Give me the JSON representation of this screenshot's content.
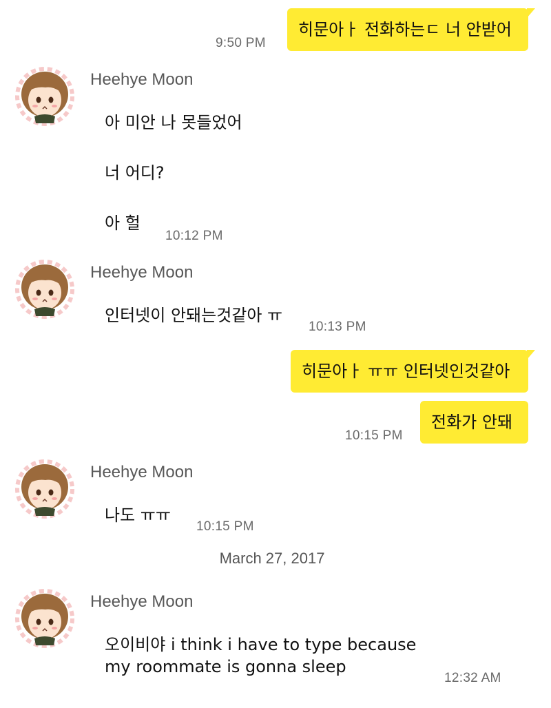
{
  "messages": {
    "m1": {
      "text": "히문아ㅏ 전화하는ㄷ 너 안받어",
      "time": "9:50 PM"
    },
    "g1": {
      "name": "Heehye Moon",
      "lines": [
        "아 미안 나 못들었어",
        "너 어디?",
        "아 헐"
      ],
      "time": "10:12 PM"
    },
    "g2": {
      "name": "Heehye Moon",
      "text": "인터넷이 안돼는것같아 ㅠ",
      "time": "10:13 PM"
    },
    "m2": {
      "text": "히문아ㅏ ㅠㅠ 인터넷인것같아"
    },
    "m3": {
      "text": "전화가 안돼",
      "time": "10:15 PM"
    },
    "g3": {
      "name": "Heehye Moon",
      "text": "나도 ㅠㅠ",
      "time": "10:15 PM"
    },
    "date_divider": "March 27, 2017",
    "g4": {
      "name": "Heehye Moon",
      "line1": "오이비야 i think i have to type because",
      "line2": "my roommate is gonna sleep",
      "time": "12:32 AM"
    }
  },
  "colors": {
    "outgoing_bubble": "#ffeb33",
    "time_text": "#6a6a6a",
    "name_text": "#585858"
  },
  "icons": {
    "avatar": "cartoon-avatar-icon"
  }
}
